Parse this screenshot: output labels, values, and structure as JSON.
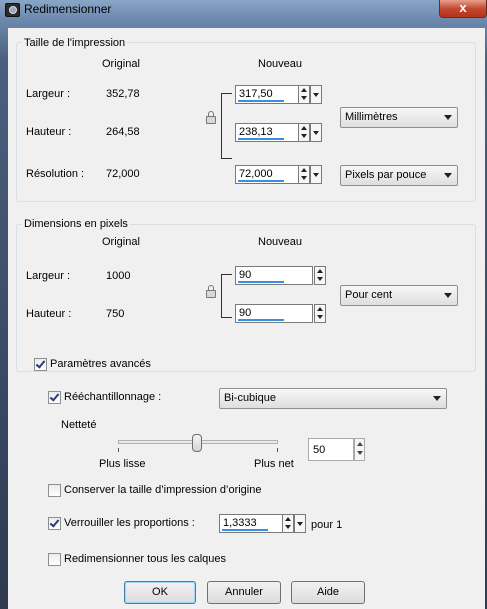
{
  "window": {
    "title": "Redimensionner",
    "close_glyph": "x"
  },
  "print_size": {
    "group_label": "Taille de l'impression",
    "col_original": "Original",
    "col_new": "Nouveau",
    "width_label": "Largeur :",
    "width_original": "352,78",
    "width_new": "317,50",
    "height_label": "Hauteur :",
    "height_original": "264,58",
    "height_new": "238,13",
    "resolution_label": "Résolution :",
    "resolution_original": "72,000",
    "resolution_new": "72,000",
    "unit_selected": "Millimètres",
    "resolution_unit_selected": "Pixels par pouce"
  },
  "pixel_dimensions": {
    "group_label": "Dimensions en pixels",
    "col_original": "Original",
    "col_new": "Nouveau",
    "width_label": "Largeur :",
    "width_original": "1000",
    "width_new": "90",
    "height_label": "Hauteur :",
    "height_original": "750",
    "height_new": "90",
    "unit_selected": "Pour cent"
  },
  "advanced": {
    "advanced_label": "Paramètres avancés",
    "advanced_checked": true,
    "resample_label": "Rééchantillonnage :",
    "resample_checked": true,
    "resample_method": "Bi-cubique",
    "sharpness_label": "Netteté",
    "sharpness_min_label": "Plus lisse",
    "sharpness_max_label": "Plus net",
    "sharpness_value": "50",
    "sharpness_fraction": 0.5,
    "keep_print_size_label": "Conserver la taille d’impression d’origine",
    "keep_print_size_checked": false,
    "lock_ratio_label": "Verrouiller les proportions :",
    "lock_ratio_checked": true,
    "ratio_value": "1,3333",
    "ratio_suffix": "pour 1",
    "resize_all_layers_label": "Redimensionner tous les calques",
    "resize_all_layers_checked": false
  },
  "buttons": {
    "ok": "OK",
    "cancel": "Annuler",
    "help": "Aide"
  }
}
